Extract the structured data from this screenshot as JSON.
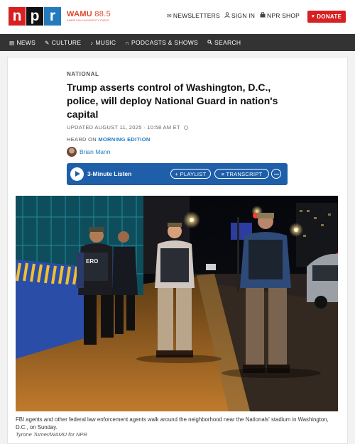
{
  "header": {
    "logo_letters": [
      "n",
      "p",
      "r"
    ],
    "station_name": "WAMU",
    "station_freq": "88.5",
    "station_tagline": "AMERICAN UNIVERSITY RADIO",
    "newsletters": "NEWSLETTERS",
    "sign_in": "SIGN IN",
    "npr_shop": "NPR SHOP",
    "donate": "DONATE"
  },
  "nav": {
    "items": [
      {
        "label": "NEWS",
        "icon": "news-icon"
      },
      {
        "label": "CULTURE",
        "icon": "culture-icon"
      },
      {
        "label": "MUSIC",
        "icon": "music-icon"
      },
      {
        "label": "PODCASTS & SHOWS",
        "icon": "podcast-icon"
      },
      {
        "label": "SEARCH",
        "icon": "search-icon"
      }
    ]
  },
  "article": {
    "slug": "NATIONAL",
    "headline": "Trump asserts control of Washington, D.C., police, will deploy National Guard in nation's capital",
    "dateline": "UPDATED AUGUST 11, 2025 · 10:58 AM ET",
    "heard_on_prefix": "HEARD ON ",
    "heard_on_show": "MORNING EDITION",
    "author": "Brian Mann"
  },
  "audio": {
    "listen_label": "3-Minute Listen",
    "playlist_label": "+ PLAYLIST",
    "transcript_label": "≡ TRANSCRIPT"
  },
  "photo": {
    "vest_label": "ERO",
    "caption": "FBI agents and other federal law enforcement agents walk around the neighborhood near the Nationals' stadium in Washington, D.C., on Sunday.",
    "credit": "Tyrone Turner/WAMU for NPR"
  },
  "colors": {
    "npr_red": "#d62021",
    "npr_blue": "#237bbd",
    "audio_bar": "#1f5fa9",
    "nav_bg": "#333333"
  }
}
